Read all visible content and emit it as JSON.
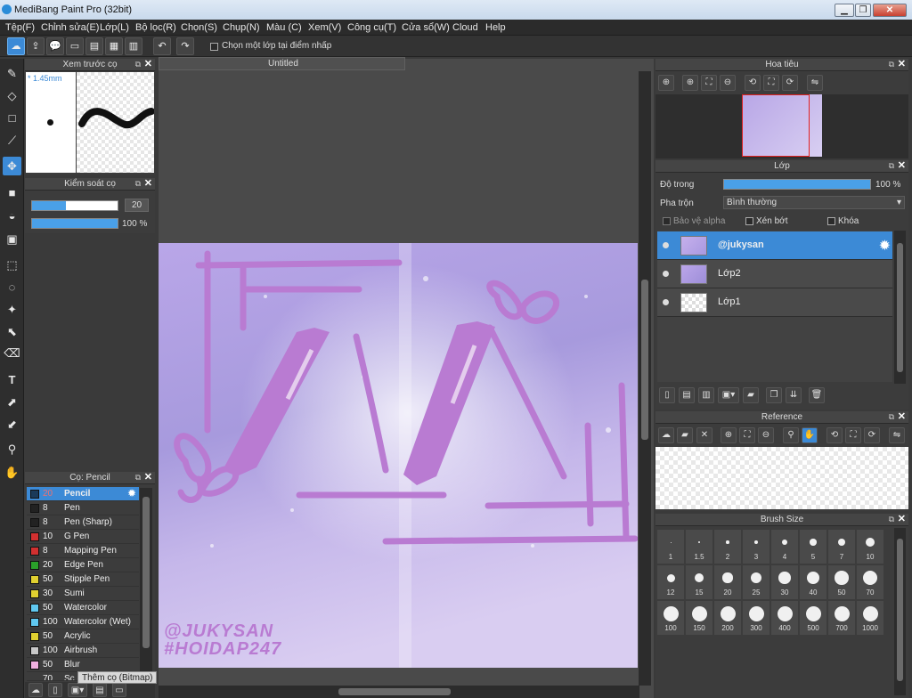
{
  "window": {
    "title": "MediBang Paint Pro (32bit)"
  },
  "menu": [
    "Tệp(F)",
    "Chỉnh sửa(E)",
    "Lớp(L)",
    "Bộ lọc(R)",
    "Chọn(S)",
    "Chụp(N)",
    "Màu (C)",
    "Xem(V)",
    "Công cụ(T)",
    "Cửa sổ(W)",
    "Cloud",
    "Help"
  ],
  "toolbar": {
    "select_layer_label": "Chọn một lớp tại điểm nhấp"
  },
  "brush_preview": {
    "title": "Xem trước cọ",
    "size_label": "* 1.45mm"
  },
  "brush_control": {
    "title": "Kiểm soát cọ",
    "size_value": "20",
    "opacity_value": "100 %",
    "size_fraction": 0.4,
    "opacity_fraction": 1.0
  },
  "document": {
    "tab_label": "Untitled"
  },
  "canvas": {
    "watermark_line1": "@JUKYSAN",
    "watermark_line2": "#HOIDAP247"
  },
  "brush_list": {
    "title": "Cọ: Pencil",
    "items": [
      {
        "size": "20",
        "name": "Pencil",
        "color": "#1a3a5a",
        "selected": true
      },
      {
        "size": "8",
        "name": "Pen",
        "color": "#222222"
      },
      {
        "size": "8",
        "name": "Pen (Sharp)",
        "color": "#222222"
      },
      {
        "size": "10",
        "name": "G Pen",
        "color": "#d23030"
      },
      {
        "size": "8",
        "name": "Mapping Pen",
        "color": "#d23030"
      },
      {
        "size": "20",
        "name": "Edge Pen",
        "color": "#2aa02a"
      },
      {
        "size": "50",
        "name": "Stipple Pen",
        "color": "#e0d030"
      },
      {
        "size": "30",
        "name": "Sumi",
        "color": "#e0d030"
      },
      {
        "size": "50",
        "name": "Watercolor",
        "color": "#60c8f0"
      },
      {
        "size": "100",
        "name": "Watercolor (Wet)",
        "color": "#60c8f0"
      },
      {
        "size": "50",
        "name": "Acrylic",
        "color": "#e0d030"
      },
      {
        "size": "100",
        "name": "Airbrush",
        "color": "#c8c8c8"
      },
      {
        "size": "50",
        "name": "Blur",
        "color": "#f0b0e0"
      }
    ],
    "partial_row": {
      "size": "70",
      "name": "Sc"
    },
    "tooltip": "Thêm cọ (Bitmap)"
  },
  "navigator": {
    "title": "Hoa tiêu"
  },
  "layers": {
    "title": "Lớp",
    "opacity_label": "Độ trong",
    "opacity_value": "100 %",
    "opacity_fraction": 1.0,
    "blend_label": "Pha trộn",
    "blend_value": "Bình thường",
    "protect_alpha": "Bảo vệ alpha",
    "clipping": "Xén bớt",
    "lock": "Khóa",
    "items": [
      {
        "name": "@jukysan",
        "selected": true
      },
      {
        "name": "Lớp2"
      },
      {
        "name": "Lớp1"
      }
    ]
  },
  "reference": {
    "title": "Reference"
  },
  "brush_size": {
    "title": "Brush Size",
    "sizes": [
      "1",
      "1.5",
      "2",
      "3",
      "4",
      "5",
      "7",
      "10",
      "12",
      "15",
      "20",
      "25",
      "30",
      "40",
      "50",
      "70",
      "100",
      "150",
      "200",
      "300",
      "400",
      "500",
      "700",
      "1000"
    ]
  },
  "colors": {
    "accent": "#3c8ad6",
    "stroke": "#c47ed0"
  }
}
